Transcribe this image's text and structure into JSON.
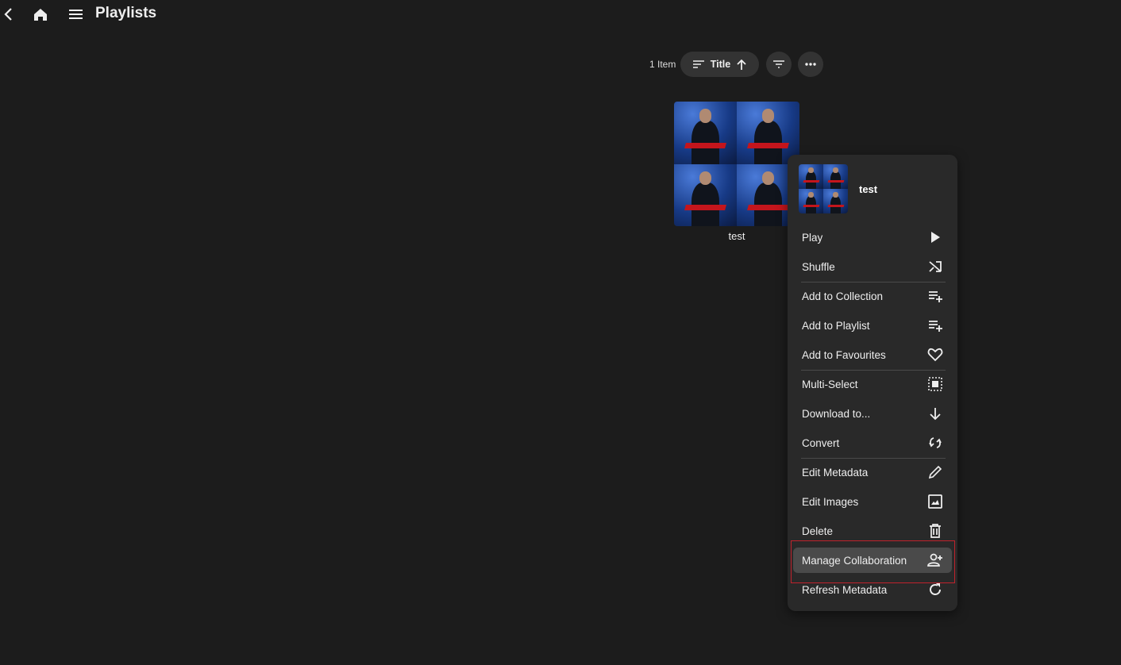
{
  "header": {
    "title": "Playlists",
    "icons": [
      "back-icon",
      "home-icon",
      "menu-icon"
    ]
  },
  "toolbar": {
    "item_count": "1 Item",
    "sort_label": "Title"
  },
  "library": {
    "items": [
      {
        "title": "test"
      }
    ]
  },
  "context_menu": {
    "title": "test",
    "items": [
      {
        "label": "Play",
        "icon": "play-icon"
      },
      {
        "label": "Shuffle",
        "icon": "shuffle-icon"
      },
      {
        "label": "Add to Collection",
        "icon": "playlist-add-icon"
      },
      {
        "label": "Add to Playlist",
        "icon": "playlist-add-icon"
      },
      {
        "label": "Add to Favourites",
        "icon": "heart-icon"
      },
      {
        "label": "Multi-Select",
        "icon": "select-all-icon"
      },
      {
        "label": "Download to...",
        "icon": "download-icon"
      },
      {
        "label": "Convert",
        "icon": "convert-icon"
      },
      {
        "label": "Edit Metadata",
        "icon": "pencil-icon"
      },
      {
        "label": "Edit Images",
        "icon": "image-icon"
      },
      {
        "label": "Delete",
        "icon": "trash-icon"
      },
      {
        "label": "Manage Collaboration",
        "icon": "person-add-icon"
      },
      {
        "label": "Refresh Metadata",
        "icon": "refresh-icon"
      }
    ],
    "highlighted_index": 11
  },
  "colors": {
    "background": "#1c1c1c",
    "menu": "#292929",
    "highlight": "#4a4a4a",
    "focus_border": "#c0222c"
  }
}
